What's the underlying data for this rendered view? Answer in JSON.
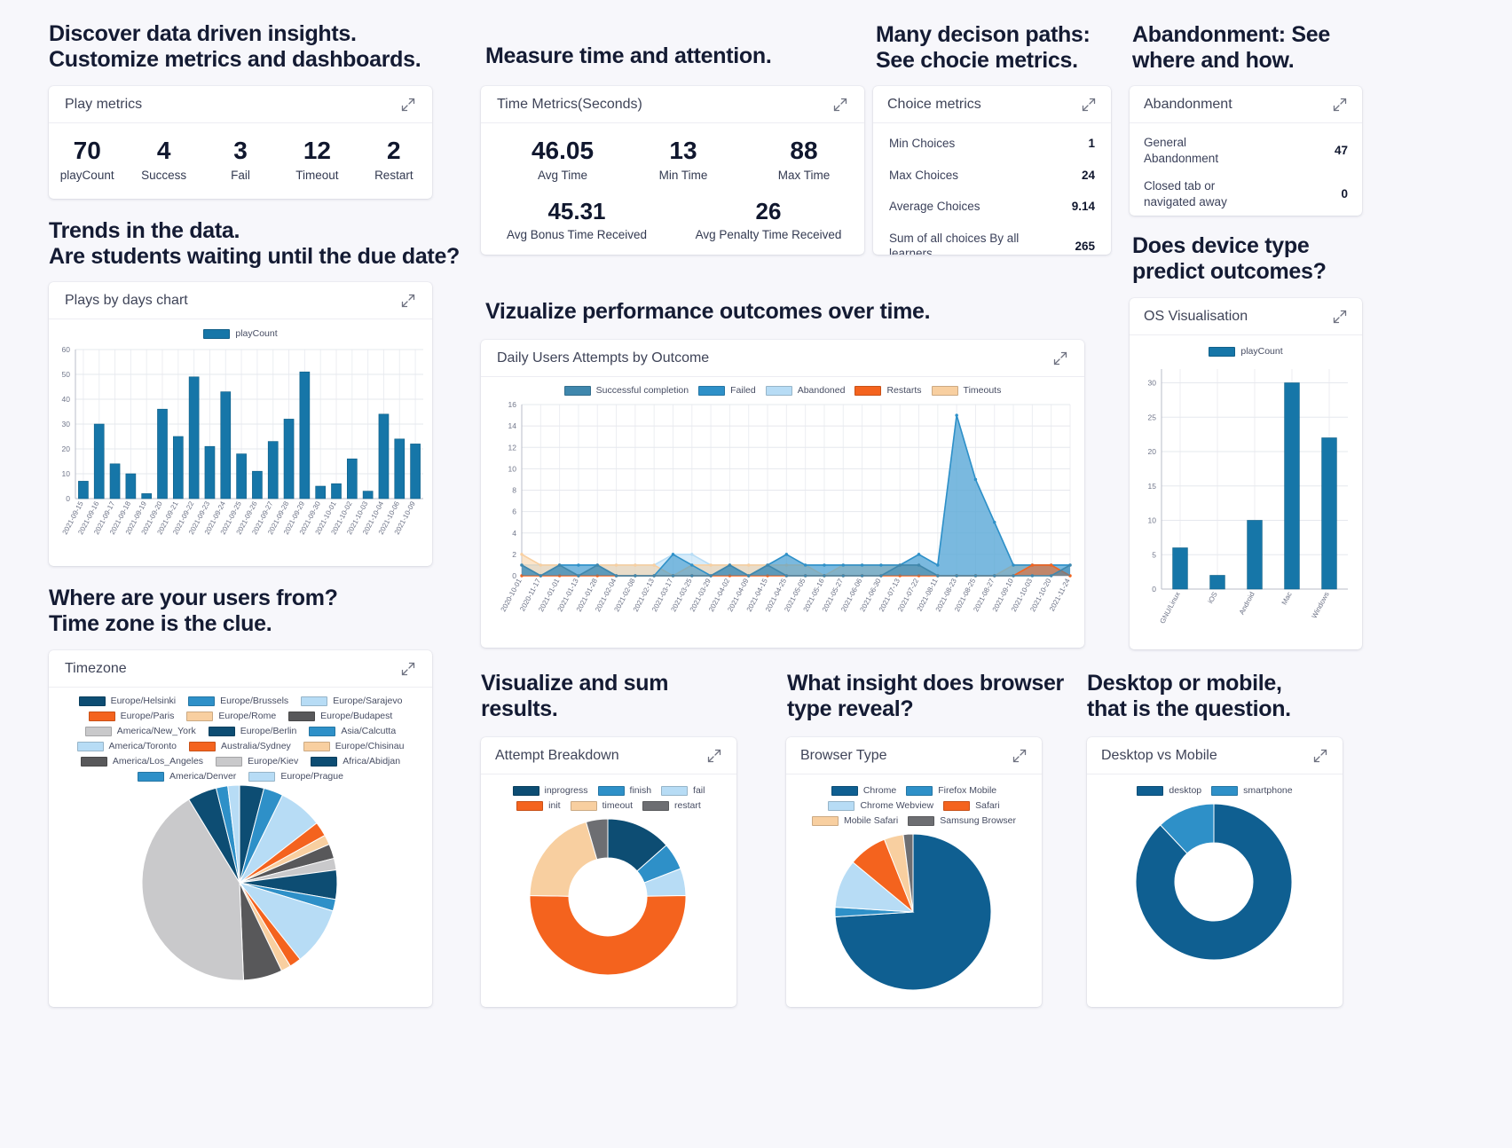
{
  "headlines": {
    "h1": "Discover data driven insights.\nCustomize metrics and dashboards.",
    "h2": "Measure time and attention.",
    "h3": "Many decison paths:\nSee chocie metrics.",
    "h4": "Abandonment: See\nwhere and how.",
    "h5": "Trends in the data.\nAre students waiting until the due date?",
    "h6": "Vizualize performance outcomes over time.",
    "h7": "Does device type\npredict outcomes?",
    "h8": "Where are your users from?\nTime zone is the clue.",
    "h9": "Visualize and sum\nresults.",
    "h10": "What insight does browser\ntype reveal?",
    "h11": "Desktop or mobile,\nthat is the question."
  },
  "play_metrics": {
    "title": "Play metrics",
    "items": [
      {
        "value": "70",
        "label": "playCount"
      },
      {
        "value": "4",
        "label": "Success"
      },
      {
        "value": "3",
        "label": "Fail"
      },
      {
        "value": "12",
        "label": "Timeout"
      },
      {
        "value": "2",
        "label": "Restart"
      }
    ]
  },
  "time_metrics": {
    "title": "Time Metrics(Seconds)",
    "row1": [
      {
        "value": "46.05",
        "label": "Avg Time"
      },
      {
        "value": "13",
        "label": "Min Time"
      },
      {
        "value": "88",
        "label": "Max Time"
      }
    ],
    "row2": [
      {
        "value": "45.31",
        "label": "Avg Bonus Time Received"
      },
      {
        "value": "26",
        "label": "Avg Penalty Time Received"
      }
    ]
  },
  "choice_metrics": {
    "title": "Choice metrics",
    "rows": [
      {
        "label": "Min Choices",
        "value": "1"
      },
      {
        "label": "Max Choices",
        "value": "24"
      },
      {
        "label": "Average Choices",
        "value": "9.14"
      },
      {
        "label": "Sum of all choices By all learners",
        "value": "265"
      }
    ]
  },
  "abandonment": {
    "title": "Abandonment",
    "rows": [
      {
        "label": "General Abandonment",
        "value": "47"
      },
      {
        "label": "Closed tab or navigated away",
        "value": "0"
      }
    ]
  },
  "chart_data": [
    {
      "id": "plays_by_days",
      "title": "Plays by days chart",
      "type": "bar",
      "legend": [
        "playCount"
      ],
      "legend_position": "top",
      "ylim": [
        0,
        60
      ],
      "yticks": [
        0,
        10,
        20,
        30,
        40,
        50,
        60
      ],
      "grid": true,
      "categories": [
        "2021-09-15",
        "2021-09-16",
        "2021-09-17",
        "2021-09-18",
        "2021-09-19",
        "2021-09-20",
        "2021-09-21",
        "2021-09-22",
        "2021-09-23",
        "2021-09-24",
        "2021-09-25",
        "2021-09-26",
        "2021-09-27",
        "2021-09-28",
        "2021-09-29",
        "2021-09-30",
        "2021-10-01",
        "2021-10-02",
        "2021-10-03",
        "2021-10-04",
        "2021-10-06",
        "2021-10-09"
      ],
      "values": [
        7,
        30,
        14,
        10,
        2,
        36,
        25,
        49,
        21,
        43,
        18,
        11,
        23,
        32,
        51,
        5,
        6,
        16,
        3,
        34,
        24,
        22
      ],
      "series_color": "#1676a8"
    },
    {
      "id": "daily_users_attempts",
      "title": "Daily Users Attempts by Outcome",
      "type": "area",
      "ylim": [
        0,
        16
      ],
      "yticks": [
        0,
        2,
        4,
        6,
        8,
        10,
        12,
        14,
        16
      ],
      "grid": true,
      "legend_position": "top",
      "x": [
        "2020-10-01",
        "2020-11-17",
        "2021-01-01",
        "2021-01-13",
        "2021-01-28",
        "2021-02-04",
        "2021-02-08",
        "2021-02-13",
        "2021-03-17",
        "2021-03-25",
        "2021-03-29",
        "2021-04-02",
        "2021-04-09",
        "2021-04-15",
        "2021-04-25",
        "2021-05-05",
        "2021-05-16",
        "2021-05-27",
        "2021-06-06",
        "2021-06-30",
        "2021-07-13",
        "2021-07-22",
        "2021-08-11",
        "2021-08-23",
        "2021-08-25",
        "2021-08-27",
        "2021-09-10",
        "2021-10-03",
        "2021-10-20",
        "2021-11-24"
      ],
      "series": [
        {
          "name": "Successful completion",
          "color": "#3f87ad",
          "values": [
            1,
            0,
            1,
            0,
            1,
            0,
            0,
            0,
            0,
            0,
            0,
            1,
            0,
            1,
            0,
            0,
            0,
            0,
            0,
            0,
            1,
            1,
            0,
            0,
            0,
            0,
            0,
            0,
            0,
            1
          ]
        },
        {
          "name": "Failed",
          "color": "#2e90c8",
          "values": [
            1,
            0,
            1,
            1,
            1,
            0,
            0,
            0,
            2,
            1,
            0,
            1,
            0,
            1,
            2,
            1,
            1,
            1,
            1,
            1,
            1,
            2,
            1,
            15,
            9,
            5,
            1,
            1,
            1,
            1
          ]
        },
        {
          "name": "Abandoned",
          "color": "#b7dcf5",
          "values": [
            1,
            1,
            1,
            1,
            1,
            1,
            1,
            1,
            2,
            2,
            1,
            1,
            1,
            1,
            2,
            1,
            1,
            1,
            1,
            1,
            1,
            2,
            1,
            15,
            9,
            5,
            1,
            1,
            1,
            1
          ]
        },
        {
          "name": "Restarts",
          "color": "#f4631e",
          "values": [
            0,
            0,
            0,
            0,
            0,
            0,
            0,
            0,
            0,
            0,
            0,
            0,
            0,
            0,
            0,
            0,
            0,
            0,
            0,
            0,
            0,
            0,
            0,
            0,
            0,
            0,
            0,
            1,
            1,
            0
          ]
        },
        {
          "name": "Timeouts",
          "color": "#f8cfa0",
          "values": [
            2,
            1,
            1,
            0,
            1,
            1,
            1,
            1,
            0,
            1,
            1,
            1,
            1,
            1,
            1,
            1,
            0,
            1,
            1,
            1,
            1,
            1,
            0,
            0,
            0,
            0,
            1,
            1,
            1,
            0
          ]
        }
      ]
    },
    {
      "id": "os_visualisation",
      "title": "OS Visualisation",
      "type": "bar",
      "legend": [
        "playCount"
      ],
      "legend_position": "top",
      "ylim": [
        0,
        32
      ],
      "yticks": [
        0,
        5,
        10,
        15,
        20,
        25,
        30
      ],
      "grid": true,
      "categories": [
        "GNU/Linux",
        "iOS",
        "Android",
        "Mac",
        "Windows"
      ],
      "values": [
        6,
        2,
        10,
        30,
        22
      ],
      "series_color": "#1676a8"
    },
    {
      "id": "timezone",
      "title": "Timezone",
      "type": "pie",
      "legend_position": "top",
      "labels": [
        "Europe/Helsinki",
        "Europe/Brussels",
        "Europe/Sarajevo",
        "Europe/Paris",
        "Europe/Rome",
        "Europe/Budapest",
        "America/New_York",
        "Europe/Berlin",
        "Asia/Calcutta",
        "America/Toronto",
        "Australia/Sydney",
        "Europe/Chisinau",
        "America/Los_Angeles",
        "Europe/Kiev",
        "Africa/Abidjan",
        "America/Denver",
        "Europe/Prague"
      ],
      "colors": [
        "#0d4d73",
        "#2e90c8",
        "#b7dcf5",
        "#f4631e",
        "#f8cfa0",
        "#58585a",
        "#c9c9cb",
        "#0d4d73",
        "#2e90c8",
        "#b7dcf5",
        "#f4631e",
        "#f8cfa0",
        "#58585a",
        "#c9c9cb",
        "#0d4d73",
        "#2e90c8",
        "#b7dcf5"
      ],
      "values": [
        2.5,
        2.0,
        4.5,
        1.5,
        1.0,
        1.5,
        1.2,
        3.0,
        1.2,
        6.0,
        1.2,
        1.0,
        4.0,
        26.0,
        3.0,
        1.2,
        1.2
      ]
    },
    {
      "id": "attempt_breakdown",
      "title": "Attempt Breakdown",
      "type": "pie",
      "donut": true,
      "legend_position": "top",
      "labels": [
        "inprogress",
        "finish",
        "fail",
        "init",
        "timeout",
        "restart"
      ],
      "colors": [
        "#0d4d73",
        "#2e90c8",
        "#b7dcf5",
        "#f4631e",
        "#f8cfa0",
        "#6d6e72"
      ],
      "values": [
        12,
        5,
        5,
        45,
        18,
        4
      ]
    },
    {
      "id": "browser_type",
      "title": "Browser Type",
      "type": "pie",
      "legend_position": "top",
      "labels": [
        "Chrome",
        "Firefox Mobile",
        "Chrome Webview",
        "Safari",
        "Mobile Safari",
        "Samsung Browser"
      ],
      "colors": [
        "#0f5f91",
        "#2e90c8",
        "#b7dcf5",
        "#f4631e",
        "#f8cfa0",
        "#6d6e72"
      ],
      "values": [
        74,
        2,
        10,
        8,
        4,
        2
      ]
    },
    {
      "id": "desktop_vs_mobile",
      "title": "Desktop vs Mobile",
      "type": "pie",
      "donut": true,
      "legend_position": "top",
      "labels": [
        "desktop",
        "smartphone"
      ],
      "colors": [
        "#0f5f91",
        "#2e90c8"
      ],
      "values": [
        88,
        12
      ]
    }
  ]
}
